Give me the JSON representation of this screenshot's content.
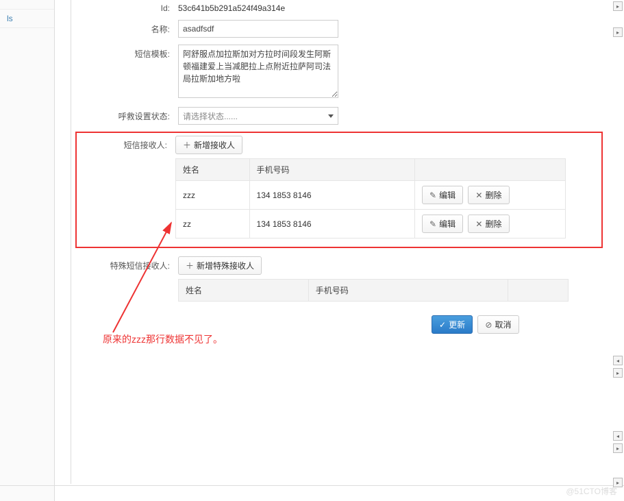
{
  "left_panel": {
    "items": [
      "",
      "ls"
    ]
  },
  "form": {
    "id_label": "Id:",
    "id_value": "53c641b5b291a524f49a314e",
    "name_label": "名称:",
    "name_value": "asadfsdf",
    "template_label": "短信模板:",
    "template_value": "阿舒服点加拉斯加对方拉时间段发生阿斯顿福建爱上当减肥拉上点附近拉萨阿司法局拉斯加地方啦",
    "status_label": "呼救设置状态:",
    "status_placeholder": "请选择状态......",
    "recipients_label": "短信接收人:",
    "add_recipient_label": "新增接收人",
    "columns": {
      "name": "姓名",
      "phone": "手机号码"
    },
    "recipients": [
      {
        "name": "zzz",
        "phone": "134 1853 8146"
      },
      {
        "name": "zz",
        "phone": "134 1853 8146"
      }
    ],
    "special_label": "特殊短信接收人:",
    "add_special_label": "新增特殊接收人",
    "special_recipients": []
  },
  "buttons": {
    "edit": "编辑",
    "delete": "删除",
    "update": "更新",
    "cancel": "取消"
  },
  "annotation": "原来的zzz那行数据不见了。",
  "watermark": "@51CTO博客"
}
